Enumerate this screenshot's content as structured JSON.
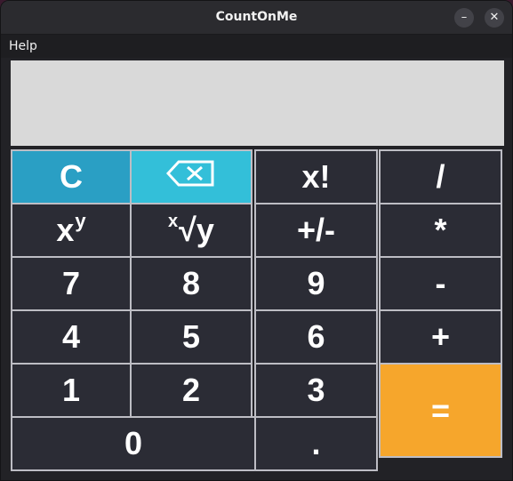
{
  "window": {
    "title": "CountOnMe",
    "minimize_glyph": "–",
    "close_glyph": "✕"
  },
  "menubar": {
    "items": [
      "Help"
    ]
  },
  "display": {
    "value": ""
  },
  "keys": {
    "clear": "C",
    "backspace_icon": "backspace-icon",
    "factorial": "x!",
    "divide": "/",
    "power_base": "x",
    "power_exp": "y",
    "root_index": "x",
    "root_body": "√y",
    "negate": "+/-",
    "multiply": "*",
    "seven": "7",
    "eight": "8",
    "nine": "9",
    "minus": "-",
    "four": "4",
    "five": "5",
    "six": "6",
    "plus": "+",
    "one": "1",
    "two": "2",
    "three": "3",
    "equals": "=",
    "zero": "0",
    "decimal": "."
  },
  "colors": {
    "clear_key": "#2a9fc4",
    "backspace_key": "#33bfd9",
    "equals_key": "#f6a62c",
    "key_background": "#2b2c35",
    "display_background": "#d9d9d9"
  }
}
